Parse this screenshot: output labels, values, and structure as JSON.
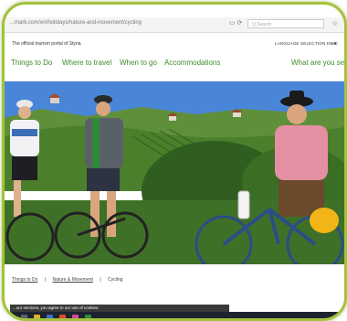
{
  "browser": {
    "url": "...mark.com/en/holidays/nature-and-movement/cycling",
    "search_placeholder": "Q Search"
  },
  "site": {
    "portal_label": "The official tourism portal of Styria",
    "language_selection": "LANGUAGE SELECTION  EN  ▾",
    "me_label": "ME"
  },
  "nav": {
    "items": [
      "Things to Do",
      "Where to travel",
      "When to go",
      "Accommodations"
    ],
    "search_label": "What are you searc"
  },
  "breadcrumb": [
    "Things to Do",
    "Nature & Movement",
    "Cycling"
  ],
  "cookie_text": "...our services, you agree to our use of cookies.",
  "colors": {
    "accent_green": "#3d8a2a",
    "frame_green": "#a3c33a"
  }
}
